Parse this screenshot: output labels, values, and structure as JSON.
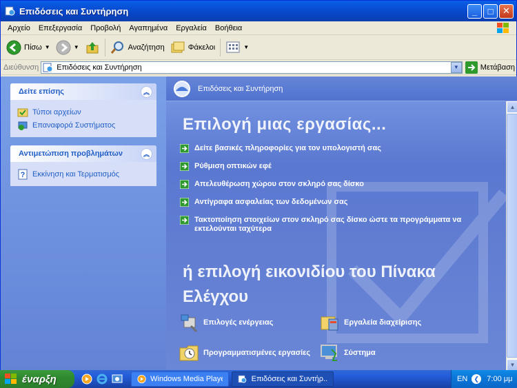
{
  "window": {
    "title": "Επιδόσεις και Συντήρηση"
  },
  "menubar": {
    "items": [
      "Αρχείο",
      "Επεξεργασία",
      "Προβολή",
      "Αγαπημένα",
      "Εργαλεία",
      "Βοήθεια"
    ]
  },
  "toolbar": {
    "back_label": "Πίσω",
    "search_label": "Αναζήτηση",
    "folders_label": "Φάκελοι"
  },
  "address": {
    "label": "Διεύθυνση",
    "value": "Επιδόσεις και Συντήρηση",
    "go_label": "Μετάβαση"
  },
  "left_pane": {
    "see_also": {
      "title": "Δείτε επίσης",
      "items": [
        "Τύποι αρχείων",
        "Επαναφορά Συστήματος"
      ]
    },
    "troubleshoot": {
      "title": "Αντιμετώπιση προβλημάτων",
      "items": [
        "Εκκίνηση και Τερματισμός"
      ]
    }
  },
  "main": {
    "category_title": "Επιδόσεις και Συντήρηση",
    "pick_task": "Επιλογή μιας εργασίας...",
    "tasks": [
      "Δείτε βασικές πληροφορίες για τον υπολογιστή σας",
      "Ρύθμιση οπτικών εφέ",
      "Απελευθέρωση χώρου στον σκληρό σας δίσκο",
      "Αντίγραφα ασφαλείας των δεδομένων σας",
      "Τακτοποίηση στοιχείων στον σκληρό σας δίσκο ώστε τα προγράμματα να εκτελούνται ταχύτερα"
    ],
    "pick_icon": "ή επιλογή εικονιδίου του Πίνακα Ελέγχου",
    "icons": [
      "Επιλογές ενέργειας",
      "Εργαλεία διαχείρισης",
      "Προγραμματισμένες εργασίες",
      "Σύστημα"
    ]
  },
  "taskbar": {
    "start_label": "έναρξη",
    "tasks": [
      "Windows Media Player",
      "Επιδόσεις και Συντήρ..."
    ],
    "lang": "EN",
    "clock": "7:00 μμ"
  }
}
